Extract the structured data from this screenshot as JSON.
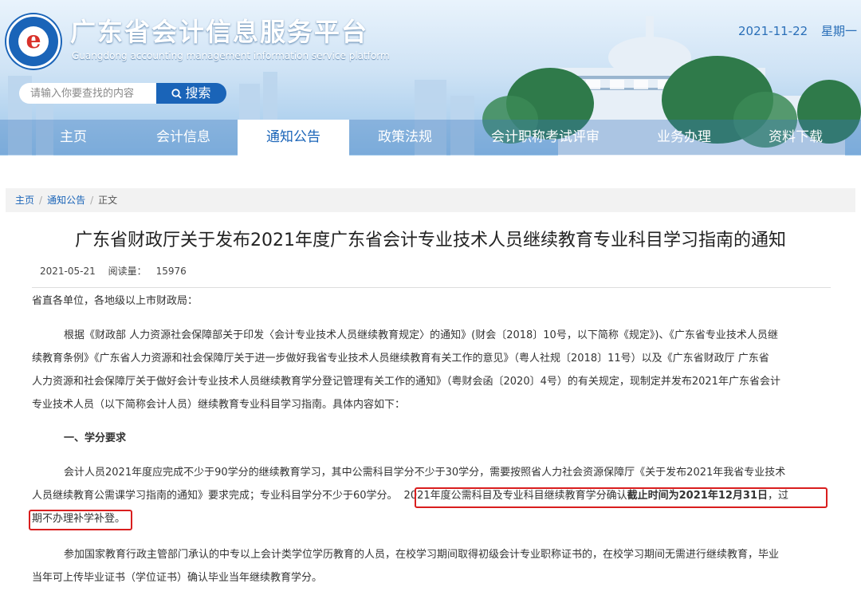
{
  "header": {
    "site_title": "广东省会计信息服务平台",
    "site_subtitle": "Guangdong accounting management information service platform",
    "date": "2021-11-22",
    "weekday": "星期一",
    "logo_icon": "logo-e-emblem"
  },
  "search": {
    "placeholder": "请输入你要查找的内容",
    "button_label": "搜索"
  },
  "nav": {
    "items": [
      "主页",
      "会计信息",
      "通知公告",
      "政策法规",
      "会计职称考试评审",
      "业务办理",
      "资料下载"
    ],
    "active": "通知公告"
  },
  "breadcrumb": {
    "home": "主页",
    "section": "通知公告",
    "current": "正文"
  },
  "article": {
    "title": "广东省财政厅关于发布2021年度广东省会计专业技术人员继续教育专业科目学习指南的通知",
    "date": "2021-05-21",
    "views_label": "阅读量：",
    "views": "15976",
    "salutation": "省直各单位，各地级以上市财政局：",
    "p1_line1": "根据《财政部 人力资源社会保障部关于印发〈会计专业技术人员继续教育规定〉的通知》(财会〔2018〕10号，以下简称《规定》)、《广东省专业技术人员继",
    "p1_line2": "续教育条例》《广东省人力资源和社会保障厅关于进一步做好我省专业技术人员继续教育有关工作的意见》（粤人社规〔2018〕11号）以及《广东省财政厅 广东省",
    "p1_line3": "人力资源和社会保障厅关于做好会计专业技术人员继续教育学分登记管理有关工作的通知》（粤财会函〔2020〕4号）的有关规定，现制定并发布2021年广东省会计",
    "p1_line4": "专业技术人员（以下简称会计人员）继续教育专业科目学习指南。具体内容如下：",
    "section1_heading": "一、学分要求",
    "p2_line1": "会计人员2021年度应完成不少于90学分的继续教育学习，其中公需科目学分不少于30学分，需要按照省人力社会资源保障厅《关于发布2021年我省专业技术",
    "p2_line2_a": "人员继续教育公需课学习指南的通知》要求完成；专业科目学分不少于60学分。",
    "p2_line2_b": "2021年度公需科目及专业科目继续教育学分确认",
    "p2_line2_bold": "截止时间为2021年12月31日",
    "p2_line2_c": "，过",
    "p2_line3": "期不办理补学补登。",
    "p3_line1": "参加国家教育行政主管部门承认的中专以上会计类学位学历教育的人员，在校学习期间取得初级会计专业职称证书的，在校学习期间无需进行继续教育，毕业",
    "p3_line2": "当年可上传毕业证书（学位证书）确认毕业当年继续教育学分。"
  },
  "colors": {
    "brand_blue": "#1a64b8",
    "highlight_red": "#d91e1e"
  }
}
